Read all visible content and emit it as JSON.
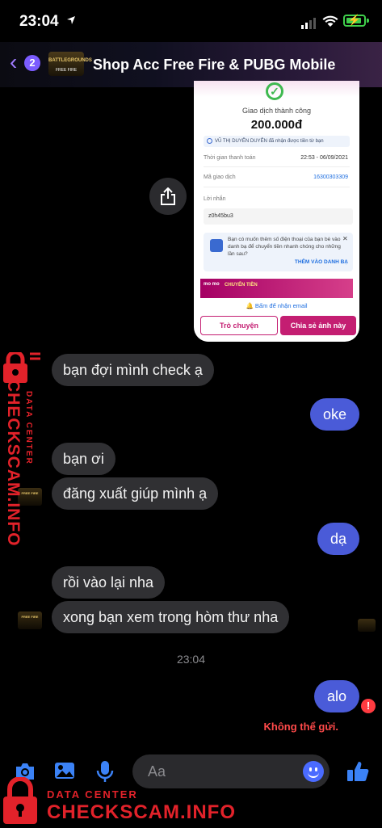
{
  "status_bar": {
    "time": "23:04",
    "location_icon": "location-arrow-icon",
    "signal_icon": "cellular-signal-icon",
    "wifi_icon": "wifi-icon",
    "battery_icon": "battery-charging-icon"
  },
  "header": {
    "back_icon": "chevron-left-icon",
    "unread_count": "2",
    "logo_line1": "BATTLEGROUNDS",
    "logo_line2": "FREE FIRE",
    "title": "Shop Acc Free Fire & PUBG Mobile"
  },
  "receipt": {
    "status": "Giao dịch thành công",
    "amount": "200.000đ",
    "note": "VŨ THỊ DUYÊN DUYÊN đã nhận được tiền từ bạn",
    "time_label": "Thời gian thanh toán",
    "time_value": "22:53 - 06/09/2021",
    "code_label": "Mã giao dịch",
    "code_value": "16300303309",
    "message_label": "Lời nhắn",
    "message_value": "z0h45bu3",
    "contact_text": "Bạn có muốn thêm số điện thoại của bạn bè vào danh bạ để chuyển tiền nhanh chóng cho những lần sau?",
    "contact_action": "THÊM VÀO DANH BẠ",
    "promo_brand": "mo mo",
    "promo_text": "CHUYỂN TIỀN",
    "email_text": "Bấm để nhận email",
    "chat_button": "Trò chuyện",
    "share_button": "Chia sẻ ảnh này"
  },
  "messages": [
    {
      "from": "them",
      "text": "bạn đợi mình check ạ"
    },
    {
      "from": "me",
      "text": "oke"
    },
    {
      "from": "them",
      "text": "bạn ơi"
    },
    {
      "from": "them",
      "text": "đăng xuất giúp mình ạ"
    },
    {
      "from": "me",
      "text": "dạ"
    },
    {
      "from": "them",
      "text": "rồi vào lại nha"
    },
    {
      "from": "them",
      "text": "xong bạn xem trong hòm thư nha"
    }
  ],
  "timestamp": "23:04",
  "last_message": {
    "text": "alo",
    "error": "Không thể gửi."
  },
  "composer": {
    "placeholder": "Aa",
    "camera_icon": "camera-icon",
    "gallery_icon": "image-icon",
    "mic_icon": "microphone-icon",
    "emoji_icon": "emoji-icon",
    "like_icon": "thumbs-up-icon"
  },
  "watermark": {
    "line1": "DATA CENTER",
    "line2": "CHECKSCAM.INFO"
  },
  "colors": {
    "accent": "#4a5bd8",
    "incoming_bubble": "#303033",
    "error": "#ff3b40",
    "watermark": "#e2222a",
    "momo": "#c41e72"
  }
}
